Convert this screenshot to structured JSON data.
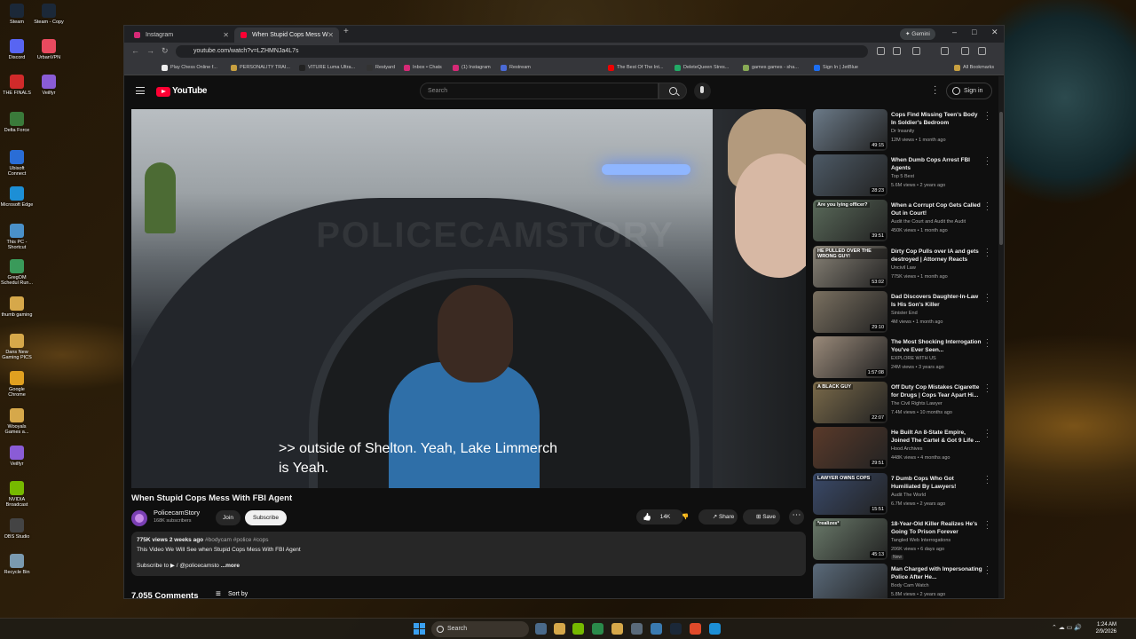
{
  "desktop": {
    "icons": [
      {
        "label": "Steam",
        "color": "#1b2838"
      },
      {
        "label": "Steam - Copy",
        "color": "#1b2838"
      },
      {
        "label": "Discord",
        "color": "#5865f2"
      },
      {
        "label": "UrbanVPN",
        "color": "#e84a5f"
      },
      {
        "label": "THE FINALS",
        "color": "#d02a2a"
      },
      {
        "label": "Veilfyr",
        "color": "#8a5cd6"
      },
      {
        "label": "Delta Force",
        "color": "#3a7a3a"
      },
      {
        "label": "Ubisoft Connect",
        "color": "#2a6dd6"
      },
      {
        "label": "Microsoft Edge",
        "color": "#1d8fd6"
      },
      {
        "label": "This PC - Shortcut",
        "color": "#4a90c8"
      },
      {
        "label": "GregOM Schedul Run...",
        "color": "#3a9a5a"
      },
      {
        "label": "thumb gaming",
        "color": "#d6a84a"
      },
      {
        "label": "Dans New Gaming PICS",
        "color": "#d6a84a"
      },
      {
        "label": "Google Chrome",
        "color": "#e0a020"
      },
      {
        "label": "Wooyals Games a...",
        "color": "#d6a84a"
      },
      {
        "label": "Veilfyr",
        "color": "#8a5cd6"
      },
      {
        "label": "NVIDIA Broadcast",
        "color": "#76b900"
      },
      {
        "label": "OBS Studio",
        "color": "#444444"
      },
      {
        "label": "Recycle Bin",
        "color": "#7a9ab0"
      }
    ]
  },
  "browser": {
    "tabs": [
      {
        "title": "Instagram"
      },
      {
        "title": "When Stupid Cops Mess W"
      }
    ],
    "gemini_label": "Gemini",
    "url": "youtube.com/watch?v=LZHMNJa4L7s",
    "bookmarks": [
      "Play Chess Online f...",
      "PERSONALITY TRAI...",
      "VITURE Luma Ultra...",
      "Restyard",
      "Inbox • Chats",
      "(1) Instagram",
      "Restream",
      "The Best Of The Int...",
      "DeleteQueen Stres...",
      "games games - sha...",
      "Sign In | JetBlue",
      "All Bookmarks"
    ]
  },
  "youtube": {
    "logo": "YouTube",
    "search_placeholder": "Search",
    "signin_label": "Sign in",
    "caption_line1": ">> outside of Shelton. Yeah, Lake Limmerch",
    "caption_line2": "is Yeah.",
    "watermark": "POLICECAMSTORY",
    "video_title": "When Stupid Cops Mess With FBI Agent",
    "channel": {
      "name": "PolicecamStory",
      "subs": "168K subscribers"
    },
    "join_label": "Join",
    "subscribe_label": "Subscribe",
    "likes": "14K",
    "share_label": "Share",
    "save_label": "Save",
    "more_label": "⋯",
    "description": {
      "views_date": "775K views  2 weeks ago",
      "tags": "#bodycam #police #cops",
      "line1": "This Video We Will See when Stupid Cops Mess With FBI Agent",
      "subscribe_line": "Subscribe to ▶ / @policecamsto",
      "more": "...more"
    },
    "comments_count": "7,055 Comments",
    "sort_label": "Sort by",
    "recommendations": [
      {
        "title": "Cops Find Missing Teen's Body In Soldier's Bedroom",
        "channel": "Dr Insanity",
        "meta": "12M views • 1 month ago",
        "duration": "49:15",
        "thumb": "#6b7a88",
        "label": ""
      },
      {
        "title": "When Dumb Cops Arrest FBI Agents",
        "channel": "Top 5 Best",
        "meta": "5.6M views • 2 years ago",
        "duration": "28:23",
        "thumb": "#4d5a66",
        "label": ""
      },
      {
        "title": "When a Corrupt Cop Gets Called Out in Court!",
        "channel": "Audit the Court and Audit the Audit",
        "meta": "450K views • 1 month ago",
        "duration": "39:51",
        "thumb": "#5a6a5a",
        "label": "Are you lying officer?"
      },
      {
        "title": "Dirty Cop Pulls over IA and gets destroyed | Attorney Reacts",
        "channel": "Uncivil Law",
        "meta": "775K views • 1 month ago",
        "duration": "53:02",
        "thumb": "#8a8478",
        "label": "HE PULLED OVER THE WRONG GUY!"
      },
      {
        "title": "Dad Discovers Daughter-In-Law Is His Son's Killer",
        "channel": "Sinister End",
        "meta": "4M views • 1 month ago",
        "duration": "29:10",
        "thumb": "#7a7060",
        "label": ""
      },
      {
        "title": "The Most Shocking Interrogation You've Ever Seen...",
        "channel": "EXPLORE WITH US",
        "meta": "24M views • 3 years ago",
        "duration": "1:57:08",
        "thumb": "#9a8a7a",
        "label": ""
      },
      {
        "title": "Off Duty Cop Mistakes Cigarette for Drugs | Cops Tear Apart Hi...",
        "channel": "The Civil Rights Lawyer",
        "meta": "7.4M views • 10 months ago",
        "duration": "22:07",
        "thumb": "#7a6a4a",
        "label": "A BLACK GUY"
      },
      {
        "title": "He Built An 8-State Empire, Joined The Cartel & Got 9 Life ...",
        "channel": "Hood Archives",
        "meta": "448K views • 4 months ago",
        "duration": "29:51",
        "thumb": "#5a3a2a",
        "label": ""
      },
      {
        "title": "7 Dumb Cops Who Got Humiliated By Lawyers!",
        "channel": "Audit The World",
        "meta": "6.7M views • 2 years ago",
        "duration": "15:51",
        "thumb": "#3a4a6a",
        "label": "LAWYER OWNS COPS"
      },
      {
        "title": "18-Year-Old Killer Realizes He's Going To Prison Forever",
        "channel": "Tangled Web Interrogations",
        "meta": "206K views • 6 days ago",
        "duration": "45:13",
        "thumb": "#6a7a6a",
        "label": "*realizes*",
        "new": "New"
      },
      {
        "title": "Man Charged with Impersonating Police After He...",
        "channel": "Body Cam Watch",
        "meta": "5.8M views • 2 years ago",
        "duration": "",
        "thumb": "#5a6a7a",
        "label": ""
      }
    ]
  },
  "taskbar": {
    "search_placeholder": "Search",
    "time": "1:24 AM",
    "date": "2/9/2026"
  }
}
